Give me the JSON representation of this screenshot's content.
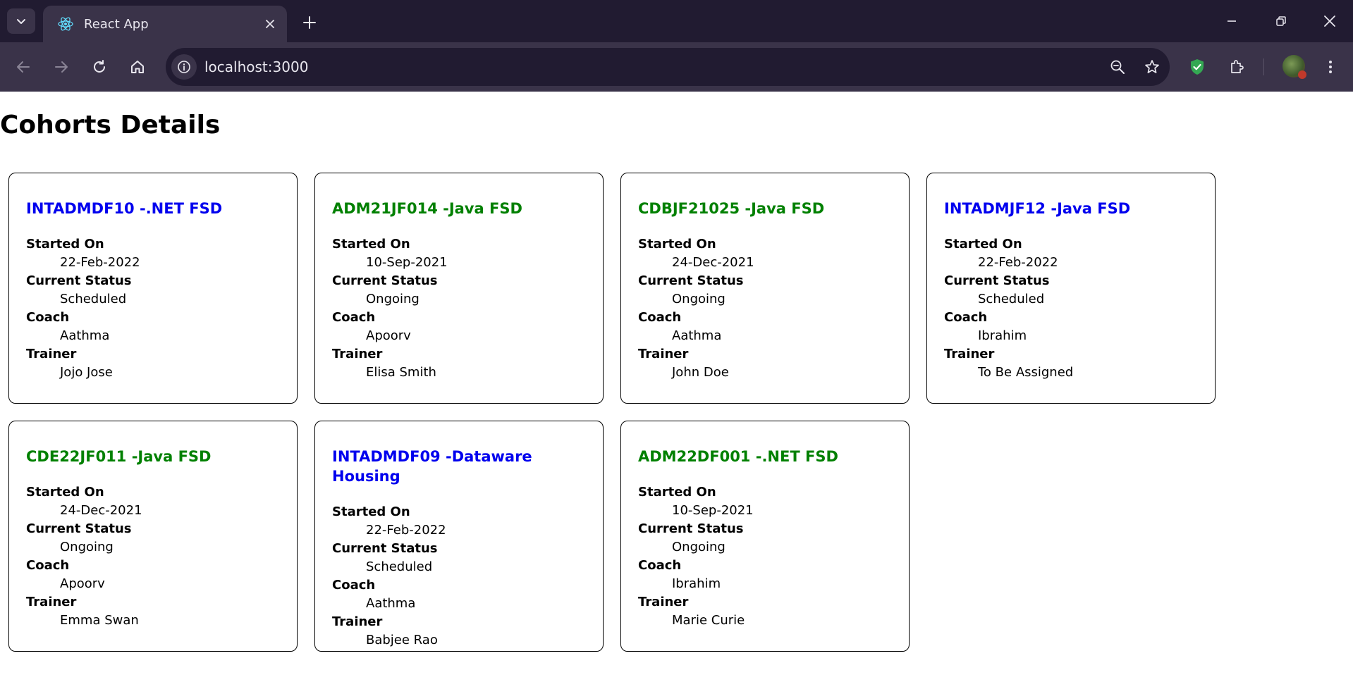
{
  "browser": {
    "tab_title": "React App",
    "url": "localhost:3000"
  },
  "page": {
    "title": "Cohorts Details"
  },
  "labels": {
    "started_on": "Started On",
    "current_status": "Current Status",
    "coach": "Coach",
    "trainer": "Trainer"
  },
  "colors": {
    "scheduled_title": "#0000ee",
    "ongoing_title": "#008000"
  },
  "cohorts": [
    {
      "title": "INTADMDF10 -.NET FSD",
      "started_on": "22-Feb-2022",
      "status": "Scheduled",
      "coach": "Aathma",
      "trainer": "Jojo Jose",
      "color": "blue"
    },
    {
      "title": "ADM21JF014 -Java FSD",
      "started_on": "10-Sep-2021",
      "status": "Ongoing",
      "coach": "Apoorv",
      "trainer": "Elisa Smith",
      "color": "green"
    },
    {
      "title": "CDBJF21025 -Java FSD",
      "started_on": "24-Dec-2021",
      "status": "Ongoing",
      "coach": "Aathma",
      "trainer": "John Doe",
      "color": "green"
    },
    {
      "title": "INTADMJF12 -Java FSD",
      "started_on": "22-Feb-2022",
      "status": "Scheduled",
      "coach": "Ibrahim",
      "trainer": "To Be Assigned",
      "color": "blue"
    },
    {
      "title": "CDE22JF011 -Java FSD",
      "started_on": "24-Dec-2021",
      "status": "Ongoing",
      "coach": "Apoorv",
      "trainer": "Emma Swan",
      "color": "green"
    },
    {
      "title": "INTADMDF09 -Dataware Housing",
      "started_on": "22-Feb-2022",
      "status": "Scheduled",
      "coach": "Aathma",
      "trainer": "Babjee Rao",
      "color": "blue"
    },
    {
      "title": "ADM22DF001 -.NET FSD",
      "started_on": "10-Sep-2021",
      "status": "Ongoing",
      "coach": "Ibrahim",
      "trainer": "Marie Curie",
      "color": "green"
    }
  ]
}
